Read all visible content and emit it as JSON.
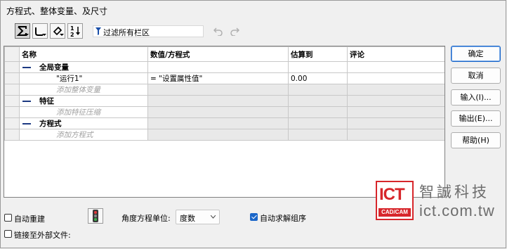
{
  "window": {
    "title": "方程式、整体变量、及尺寸"
  },
  "toolbar": {
    "filter_text": "过滤所有栏区",
    "icons": [
      "sigma-view-icon",
      "equation-view-icon",
      "sort-view-icon",
      "ordered-view-icon",
      "undo-icon",
      "redo-icon"
    ]
  },
  "table": {
    "headers": [
      "名称",
      "数值/方程式",
      "估算到",
      "评论"
    ],
    "groups": [
      {
        "label": "全局变量",
        "items": [
          {
            "name": "\"运行1\"",
            "value": "= \"设置属性值\"",
            "evaluates": "0.00",
            "comment": ""
          }
        ],
        "add_placeholder": "添加整体变量"
      },
      {
        "label": "特征",
        "items": [],
        "add_placeholder": "添加特征压缩"
      },
      {
        "label": "方程式",
        "items": [],
        "add_placeholder": "添加方程式"
      }
    ]
  },
  "buttons": {
    "ok": "确定",
    "cancel": "取消",
    "import": "输入(I)...",
    "export": "输出(E)...",
    "help": "帮助(H)"
  },
  "options": {
    "auto_rebuild": {
      "label": "自动重建",
      "checked": false
    },
    "link_external": {
      "label": "链接至外部文件:",
      "checked": false
    },
    "angle_unit_label": "角度方程单位:",
    "angle_unit_value": "度数",
    "auto_solve": {
      "label": "自动求解组序",
      "checked": true
    }
  },
  "watermark": {
    "logo": "ICT",
    "logo_sub": "CAD/CAM",
    "company": "智誠科技",
    "url": "ict.com.tw"
  },
  "colors": {
    "accent": "#1a66c9",
    "brand_red": "#d7262b"
  }
}
